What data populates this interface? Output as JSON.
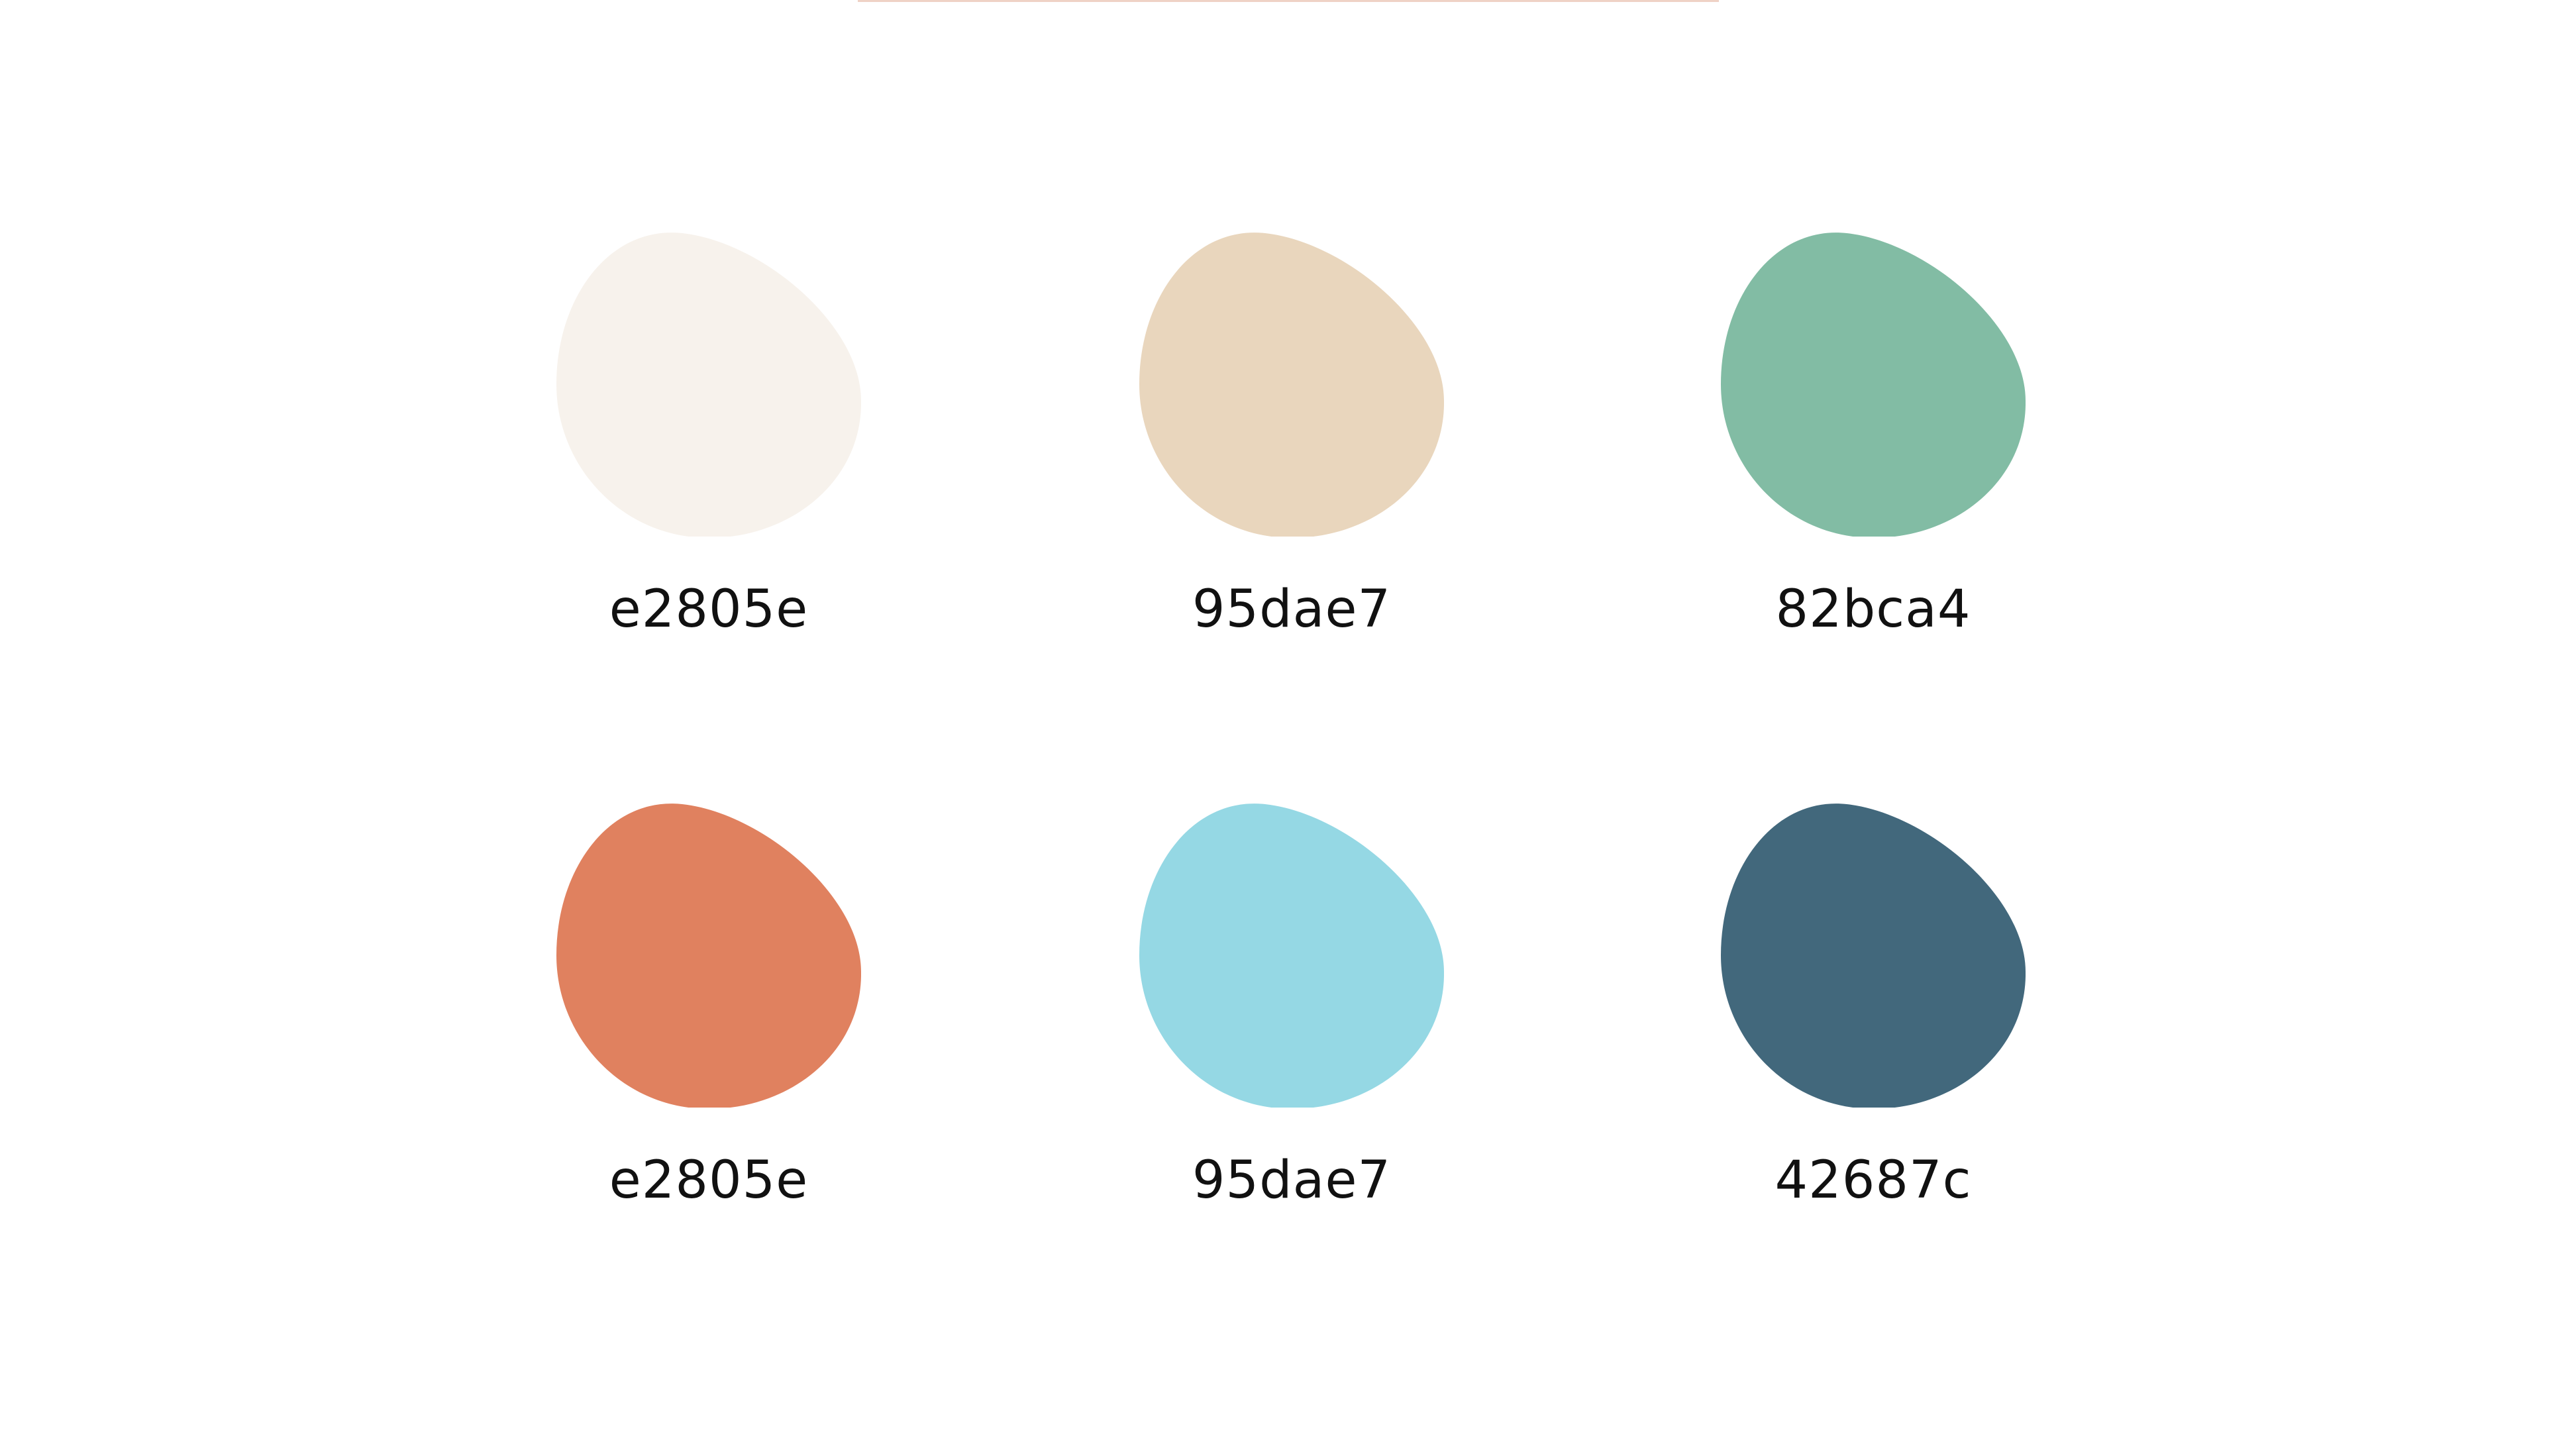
{
  "palette": {
    "swatches": [
      {
        "color": "#f7f2ec",
        "label": "e2805e"
      },
      {
        "color": "#e9d6bd",
        "label": "95dae7"
      },
      {
        "color": "#82bca4",
        "label": "82bca4"
      },
      {
        "color": "#e0815f",
        "label": "e2805e"
      },
      {
        "color": "#95d8e4",
        "label": "95dae7"
      },
      {
        "color": "#42687c",
        "label": "42687c"
      }
    ]
  }
}
